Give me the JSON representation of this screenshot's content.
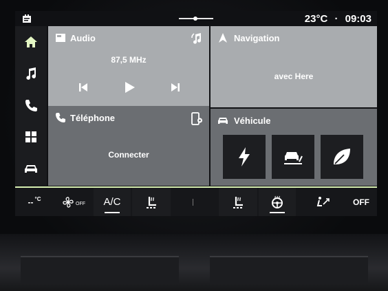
{
  "status": {
    "temperature": "23°C",
    "separator": "·",
    "time": "09:03"
  },
  "sidebar": {
    "items": [
      {
        "icon": "home-icon",
        "active": true
      },
      {
        "icon": "music-icon"
      },
      {
        "icon": "phone-icon"
      },
      {
        "icon": "apps-icon"
      },
      {
        "icon": "car-icon"
      }
    ]
  },
  "tiles": {
    "audio": {
      "title": "Audio",
      "frequency": "87,5 MHz"
    },
    "navigation": {
      "title": "Navigation",
      "subtitle": "avec Here"
    },
    "phone": {
      "title": "Téléphone",
      "action": "Connecter"
    },
    "vehicle": {
      "title": "Véhicule"
    }
  },
  "climate": {
    "temp_left": "--",
    "temp_unit": "°C",
    "fan": "OFF",
    "ac": "A/C",
    "right_status": "OFF"
  },
  "colors": {
    "tile_light": "#a9acaf",
    "tile_dark": "#6b6e72",
    "accent_line": "#d9f2b4"
  }
}
